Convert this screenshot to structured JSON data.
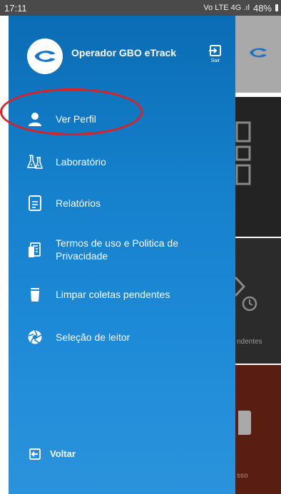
{
  "status_bar": {
    "time": "17:11",
    "signal_text": "Vo LTE 4G .ıl",
    "battery": "48%"
  },
  "drawer": {
    "operator_name": "Operador GBO eTrack",
    "logout_label": "Sair",
    "menu": [
      {
        "label": "Ver Perfil",
        "icon": "user-icon"
      },
      {
        "label": "Laboratório",
        "icon": "lab-icon"
      },
      {
        "label": "Relatórios",
        "icon": "document-icon"
      },
      {
        "label": "Termos de uso e Politica de Privacidade",
        "icon": "terms-icon"
      },
      {
        "label": "Limpar coletas pendentes",
        "icon": "trash-icon"
      },
      {
        "label": "Seleção de leitor",
        "icon": "aperture-icon"
      }
    ],
    "back_label": "Voltar"
  },
  "background": {
    "tile2_label": "ndentes",
    "tile3_label": "sso"
  },
  "colors": {
    "drawer_top": "#0a6cb4",
    "drawer_bottom": "#2b93dc",
    "highlight": "#e02020",
    "logo_blue": "#1a73c8"
  }
}
